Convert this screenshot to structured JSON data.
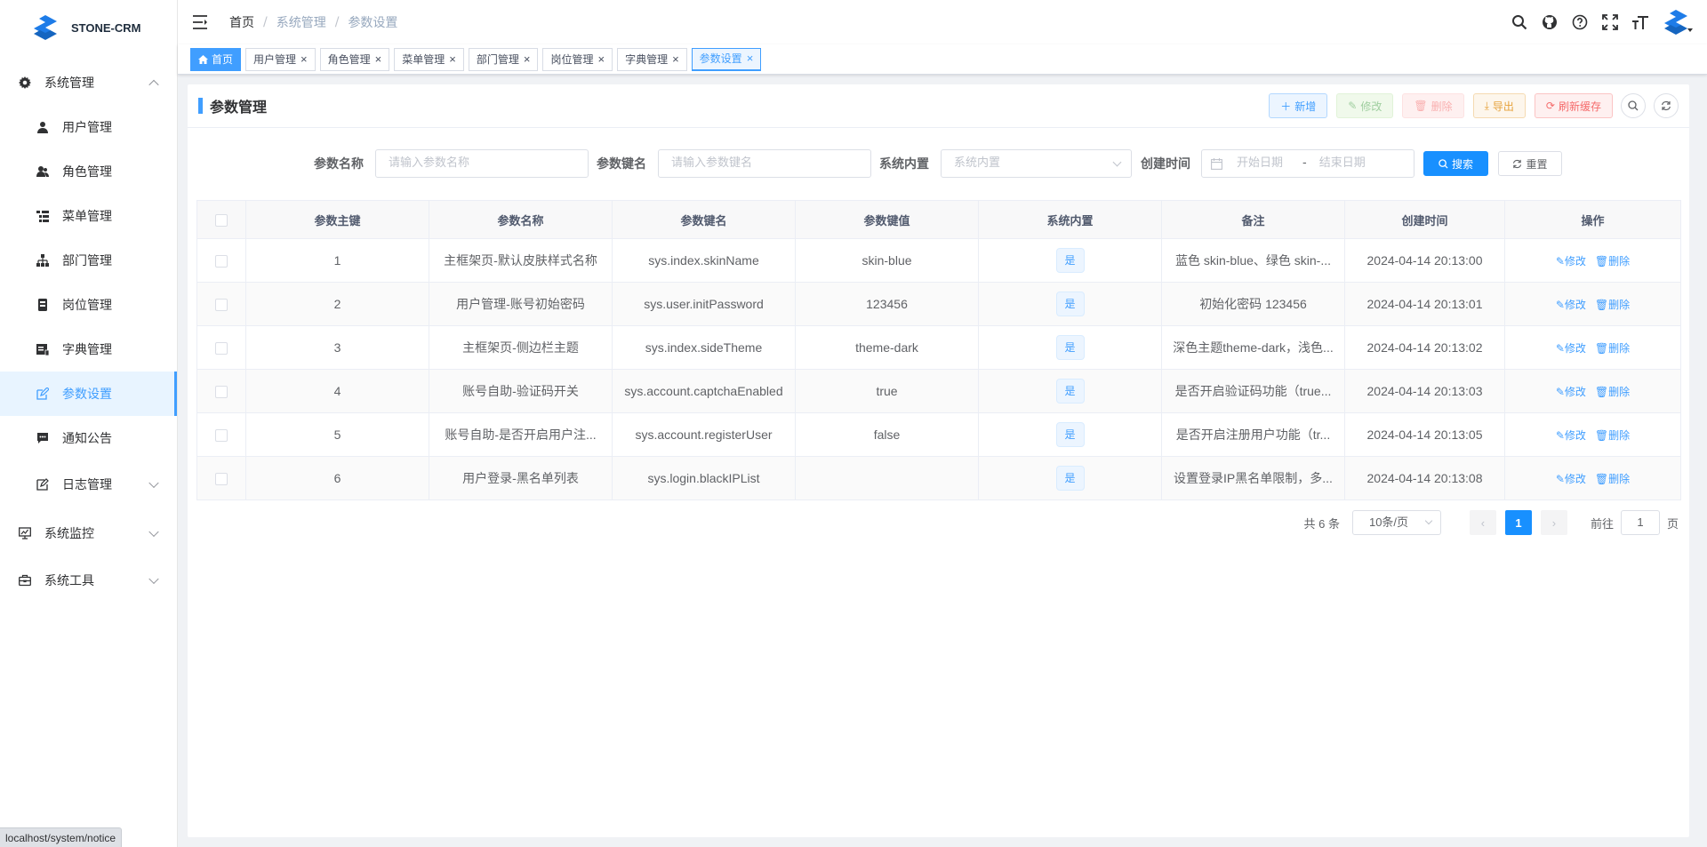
{
  "app": {
    "name": "STONE-CRM"
  },
  "sidebar": {
    "groups": [
      {
        "label": "系统管理",
        "expanded": true,
        "icon": "gear-icon"
      },
      {
        "label": "系统监控",
        "expanded": false,
        "icon": "monitor-icon"
      },
      {
        "label": "系统工具",
        "expanded": false,
        "icon": "toolbox-icon"
      }
    ],
    "items": [
      {
        "label": "用户管理",
        "icon": "user-icon"
      },
      {
        "label": "角色管理",
        "icon": "role-icon"
      },
      {
        "label": "菜单管理",
        "icon": "tree-table-icon"
      },
      {
        "label": "部门管理",
        "icon": "org-tree-icon"
      },
      {
        "label": "岗位管理",
        "icon": "post-icon"
      },
      {
        "label": "字典管理",
        "icon": "dict-icon"
      },
      {
        "label": "参数设置",
        "icon": "edit-icon",
        "active": true
      },
      {
        "label": "通知公告",
        "icon": "message-icon"
      },
      {
        "label": "日志管理",
        "icon": "log-icon",
        "has_children": true
      }
    ]
  },
  "breadcrumb": [
    "首页",
    "系统管理",
    "参数设置"
  ],
  "tags": [
    {
      "label": "首页",
      "home": true
    },
    {
      "label": "用户管理"
    },
    {
      "label": "角色管理"
    },
    {
      "label": "菜单管理"
    },
    {
      "label": "部门管理"
    },
    {
      "label": "岗位管理"
    },
    {
      "label": "字典管理"
    },
    {
      "label": "参数设置",
      "active": true
    }
  ],
  "page": {
    "title": "参数管理",
    "buttons": {
      "add": "新增",
      "edit": "修改",
      "delete": "删除",
      "export": "导出",
      "refresh": "刷新缓存"
    }
  },
  "search": {
    "config_name_label": "参数名称",
    "config_name_placeholder": "请输入参数名称",
    "config_key_label": "参数键名",
    "config_key_placeholder": "请输入参数键名",
    "config_type_label": "系统内置",
    "config_type_placeholder": "系统内置",
    "date_label": "创建时间",
    "start_placeholder": "开始日期",
    "range_sep": "-",
    "end_placeholder": "结束日期",
    "search_btn": "搜索",
    "reset_btn": "重置"
  },
  "table": {
    "columns": [
      "参数主键",
      "参数名称",
      "参数键名",
      "参数键值",
      "系统内置",
      "备注",
      "创建时间",
      "操作"
    ],
    "rows": [
      {
        "id": "1",
        "name": "主框架页-默认皮肤样式名称",
        "key": "sys.index.skinName",
        "value": "skin-blue",
        "builtin": "是",
        "remark": "蓝色 skin-blue、绿色 skin-...",
        "created": "2024-04-14 20:13:00"
      },
      {
        "id": "2",
        "name": "用户管理-账号初始密码",
        "key": "sys.user.initPassword",
        "value": "123456",
        "builtin": "是",
        "remark": "初始化密码 123456",
        "created": "2024-04-14 20:13:01"
      },
      {
        "id": "3",
        "name": "主框架页-侧边栏主题",
        "key": "sys.index.sideTheme",
        "value": "theme-dark",
        "builtin": "是",
        "remark": "深色主题theme-dark，浅色...",
        "created": "2024-04-14 20:13:02"
      },
      {
        "id": "4",
        "name": "账号自助-验证码开关",
        "key": "sys.account.captchaEnabled",
        "value": "true",
        "builtin": "是",
        "remark": "是否开启验证码功能（true...",
        "created": "2024-04-14 20:13:03"
      },
      {
        "id": "5",
        "name": "账号自助-是否开启用户注...",
        "key": "sys.account.registerUser",
        "value": "false",
        "builtin": "是",
        "remark": "是否开启注册用户功能（tr...",
        "created": "2024-04-14 20:13:05"
      },
      {
        "id": "6",
        "name": "用户登录-黑名单列表",
        "key": "sys.login.blackIPList",
        "value": "",
        "builtin": "是",
        "remark": "设置登录IP黑名单限制，多...",
        "created": "2024-04-14 20:13:08"
      }
    ],
    "row_actions": {
      "edit": "修改",
      "delete": "删除"
    }
  },
  "pagination": {
    "total_text": "共 6 条",
    "page_size": "10条/页",
    "current_page": "1",
    "goto_label": "前往",
    "goto_value": "1",
    "page_suffix": "页"
  },
  "statusbar": {
    "url": "localhost/system/notice"
  },
  "colors": {
    "primary": "#409eff",
    "search_btn": "#1890ff",
    "danger": "#f56c6c",
    "warning": "#e6a23c"
  }
}
